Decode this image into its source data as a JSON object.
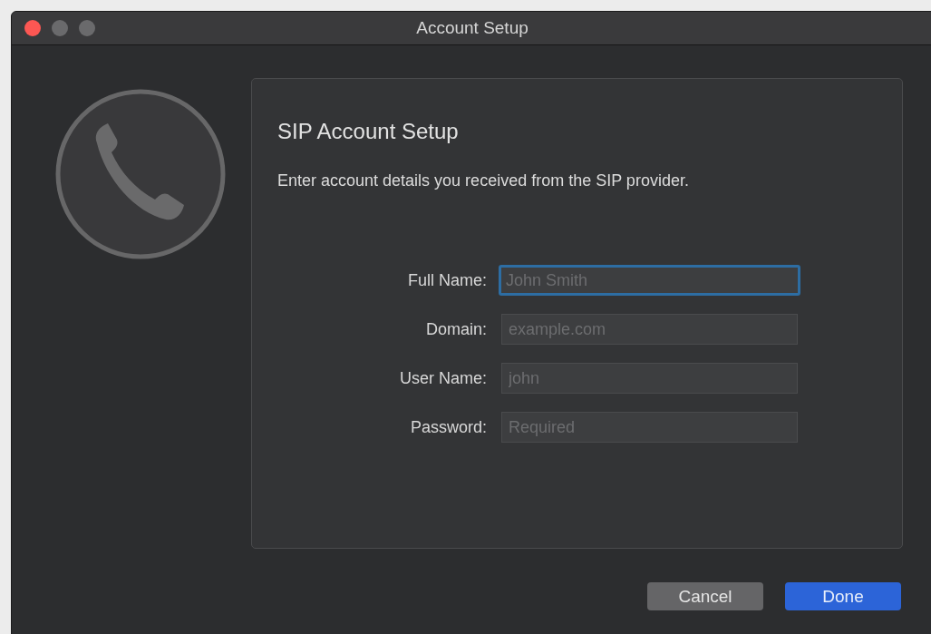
{
  "window": {
    "title": "Account Setup",
    "controls": [
      {
        "kind": "close"
      },
      {
        "kind": "minimize"
      },
      {
        "kind": "zoom"
      }
    ]
  },
  "panel": {
    "title": "SIP Account Setup",
    "description": "Enter account details you received from the SIP provider."
  },
  "fields": [
    {
      "label": "Full Name:",
      "placeholder": "John Smith",
      "focused": true
    },
    {
      "label": "Domain:",
      "placeholder": "example.com",
      "focused": false
    },
    {
      "label": "User Name:",
      "placeholder": "john",
      "focused": false
    },
    {
      "label": "Password:",
      "placeholder": "Required",
      "focused": false
    }
  ],
  "buttons": [
    {
      "label": "Cancel",
      "kind": "default"
    },
    {
      "label": "Done",
      "kind": "primary"
    }
  ]
}
